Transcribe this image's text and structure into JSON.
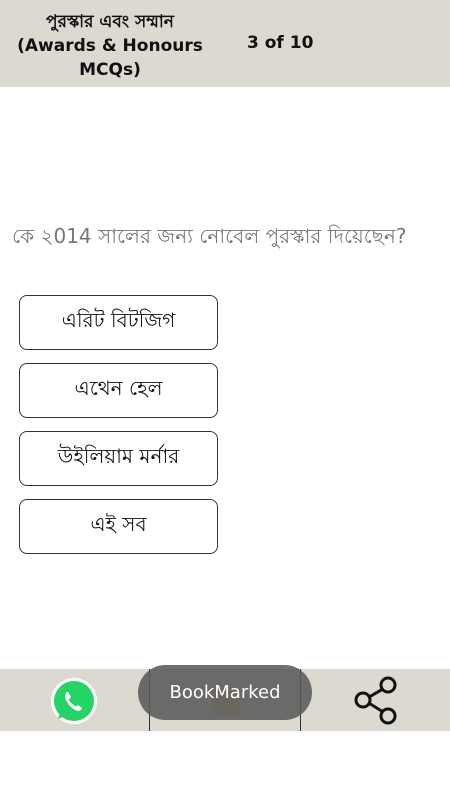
{
  "header": {
    "title_lines": [
      "পুরস্কার এবং সম্মান",
      "(Awards & Honours",
      "MCQs)"
    ],
    "counter": "3 of 10"
  },
  "question": {
    "text": "কে ২014 সালের জন্য নোবেল পুরস্কার দিয়েছেন?"
  },
  "options": [
    {
      "label": "এরিট বিটজিগ"
    },
    {
      "label": "এথেন হেল"
    },
    {
      "label": "উইলিয়াম মর্নার"
    },
    {
      "label": "এই সব"
    }
  ],
  "bottom_bar": {
    "left_icon": "whatsapp-icon",
    "middle_icon": "bookmark-icon",
    "right_icon": "share-icon",
    "accent": "#25d366"
  },
  "toast": {
    "text": "BookMarked"
  }
}
